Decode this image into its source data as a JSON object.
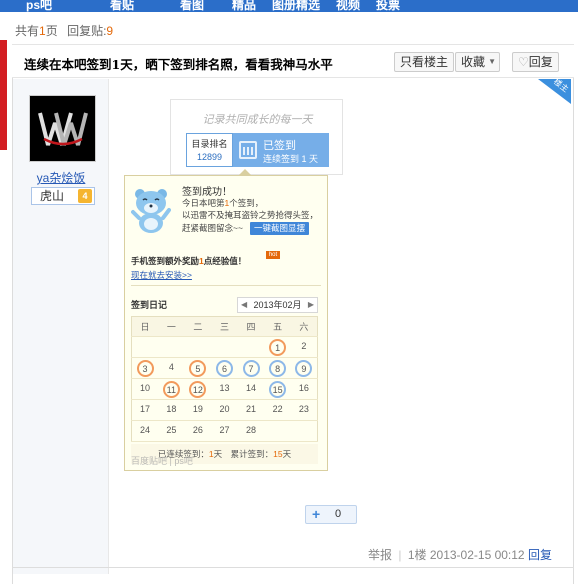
{
  "nav": {
    "items": [
      "ps吧",
      "看贴",
      "看图",
      "精品",
      "图册精选",
      "视频",
      "投票"
    ]
  },
  "info": {
    "total_prefix": "共有",
    "total_pages": "1",
    "total_suffix": "页",
    "replies_label": "回复贴:",
    "replies_count": "9"
  },
  "thread": {
    "title": "连续在本吧签到1天，晒下签到排名照，看看我神马水平",
    "only_owner_btn": "只看楼主",
    "favorite_btn": "收藏",
    "reply_btn": "回复"
  },
  "user": {
    "name": "ya杂烩饭",
    "level_name": "虎山",
    "level_num": "4"
  },
  "badge": {
    "label": "楼主"
  },
  "signin": {
    "slogan": "记录共同成长的每一天",
    "rank_label": "目录排名",
    "rank_value": "12899",
    "signed_label": "已签到",
    "streak_text": "连续签到 1 天",
    "success_title": "签到成功！",
    "today_prefix": "今日本吧第",
    "today_num": "1",
    "today_suffix": "个签到，",
    "share_line1": "以迅雷不及掩耳盗铃之势抢得头签，",
    "share_line2": "赶紧截图留念~~",
    "share_btn": "一键截图显摆",
    "mobile_prefix": "手机签到额外奖励",
    "mobile_num": "1",
    "mobile_suffix": "点经验值！",
    "hot": "hot",
    "install_link": "现在就去安装>>",
    "diary_title": "签到日记",
    "month": "2013年02月",
    "weekdays": [
      "日",
      "一",
      "二",
      "三",
      "四",
      "五",
      "六"
    ],
    "weeks": [
      [
        "",
        "",
        "",
        "",
        "",
        "1",
        "2"
      ],
      [
        "3",
        "4",
        "5",
        "6",
        "7",
        "8",
        "9"
      ],
      [
        "10",
        "11",
        "12",
        "13",
        "14",
        "15",
        "16"
      ],
      [
        "17",
        "18",
        "19",
        "20",
        "21",
        "22",
        "23"
      ],
      [
        "24",
        "25",
        "26",
        "27",
        "28",
        "",
        ""
      ]
    ],
    "orange_days": [
      "1",
      "3",
      "5",
      "11",
      "12"
    ],
    "blue_days": [
      "6",
      "7",
      "8",
      "9",
      "15"
    ],
    "summary_prefix": "已连续签到：",
    "summary_days": "1",
    "summary_mid": "天　累计签到：",
    "summary_total": "15",
    "summary_suffix": "天",
    "watermark": "百度贴吧 | ps吧"
  },
  "like": {
    "icon": "plus-icon",
    "count": "0"
  },
  "footer": {
    "report": "举报",
    "floor": "1楼",
    "date": "2013-02-15 00:12",
    "reply": "回复"
  },
  "colors": {
    "nav_blue": "#2b6ec9",
    "accent_orange": "#e4690a",
    "link_blue": "#2659b5"
  }
}
